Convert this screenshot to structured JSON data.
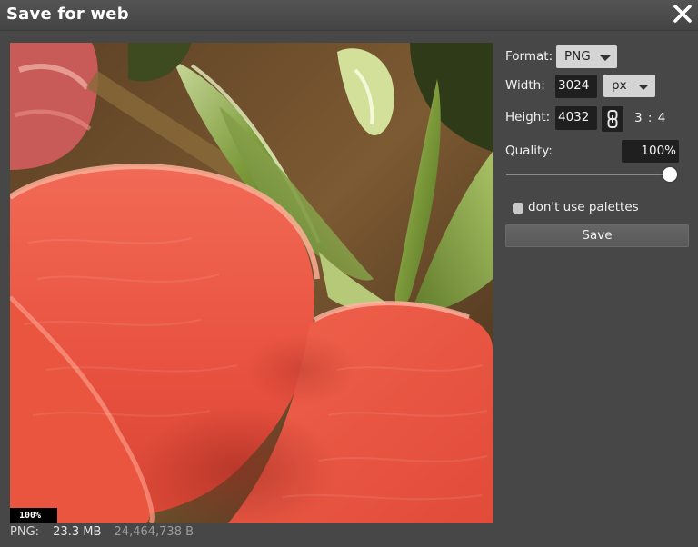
{
  "dialog": {
    "title": "Save for web",
    "close_icon": "close-icon"
  },
  "preview": {
    "zoom": "100%",
    "icon": "flower-photo-preview"
  },
  "file_status": {
    "format": "PNG:",
    "size_mb": "23.3 MB",
    "size_bytes": "24,464,738 B"
  },
  "settings": {
    "format_label": "Format:",
    "format_value": "PNG",
    "width_label": "Width:",
    "width_value": "3024",
    "unit_value": "px",
    "height_label": "Height:",
    "height_value": "4032",
    "link_icon": "chain-link-icon",
    "aspect_ratio": "3 : 4",
    "quality_label": "Quality:",
    "quality_value": "100%",
    "quality_level": 1.0,
    "palette_label": "don't use palettes",
    "palette_checked": false,
    "save_label": "Save"
  },
  "colors": {
    "background": "#474747",
    "titlebar": "#4e4e4e",
    "input_dark": "#1f1f1f",
    "dropdown": "#d4d4d4",
    "petal": "#e8503e"
  }
}
